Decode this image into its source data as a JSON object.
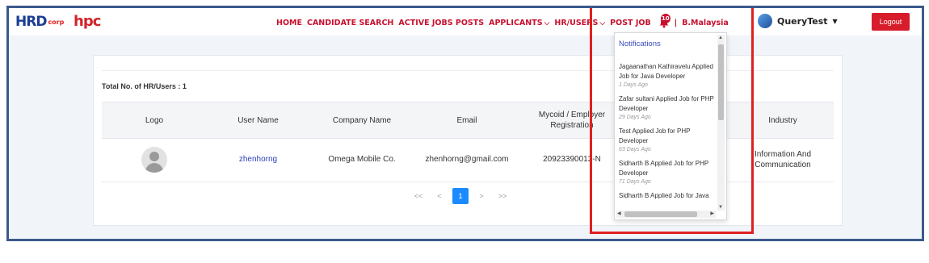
{
  "brand": {
    "hrd": "HRD",
    "corp": "corp",
    "hpc": "hpc"
  },
  "nav": {
    "home": "HOME",
    "candidate_search": "CANDIDATE SEARCH",
    "active_jobs": "ACTIVE JOBS POSTS",
    "applicants": "APPLICANTS",
    "hr_users": "HR/USERS",
    "post_job": "POST JOB",
    "notification_count": "10",
    "separator": "|",
    "org": "B.Malaysia"
  },
  "user": {
    "name": "QueryTest"
  },
  "logout_label": "Logout",
  "table": {
    "total_label": "Total No. of HR/Users : 1",
    "headers": [
      "Logo",
      "User Name",
      "Company Name",
      "Email",
      "Mycoid / Employer Registration",
      "Industry"
    ],
    "rows": [
      {
        "username": "zhenhorng",
        "company": "Omega Mobile Co.",
        "email": "zhenhorng@gmail.com",
        "mycoid": "20923390013-N",
        "industry": "Information And Communication"
      }
    ]
  },
  "pagination": {
    "first": "<<",
    "prev": "<",
    "current": "1",
    "next": ">",
    "last": ">>"
  },
  "notifications": {
    "title": "Notifications",
    "items": [
      {
        "text": "Jagaanathan Kathiravelu Applied Job for Java Developer",
        "time": "1 Days Ago"
      },
      {
        "text": "Zafar sultani Applied Job for PHP Developer",
        "time": "29 Days Ago"
      },
      {
        "text": "Test Applied Job for PHP Developer",
        "time": "63 Days Ago"
      },
      {
        "text": "Sidharth B Applied Job for PHP Developer",
        "time": "71 Days Ago"
      },
      {
        "text": "Sidharth B Applied Job for Java",
        "time": ""
      }
    ]
  },
  "colors": {
    "accent": "#c8102e",
    "frame": "#3b5a8c",
    "highlight": "#e02020",
    "active_page": "#1a8cff"
  }
}
